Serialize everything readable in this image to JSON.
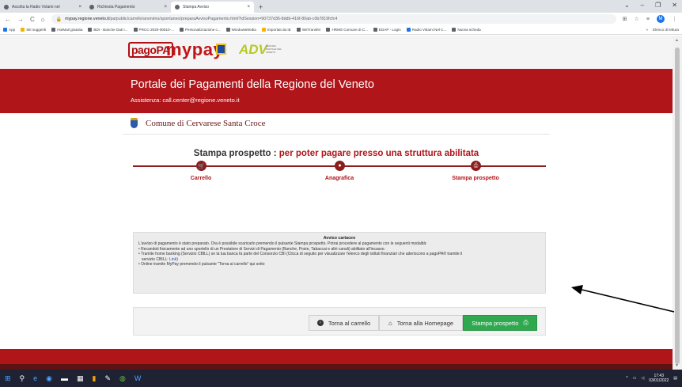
{
  "browser": {
    "tabs": [
      {
        "title": "Ascolta la Radio Volami nel",
        "close": "×",
        "active": false
      },
      {
        "title": "Richiesta Pagamento",
        "close": "×",
        "active": false
      },
      {
        "title": "Stampa Avviso",
        "close": "×",
        "active": true
      }
    ],
    "new_tab": "+",
    "url_host": "mypay.regione.veneto.it",
    "url_path": "/pa/public/carrello/anonimo/spontaneo/preparaAvvisoPagamento.html?idSession=90737d36-8ddb-416f-80ab-c0b7819fcfc4",
    "bookmarks": [
      {
        "label": "App",
        "color": "blue"
      },
      {
        "label": "Siti suggeriti",
        "color": "yellow"
      },
      {
        "label": "HotMail gratuita",
        "color": "grey"
      },
      {
        "label": "BDI - Banche Dati I...",
        "color": "grey"
      },
      {
        "label": "PRCC-2020-00510-...",
        "color": "grey"
      },
      {
        "label": "Personalizzazione c...",
        "color": "grey"
      },
      {
        "label": "WindowsMedia",
        "color": "grey"
      },
      {
        "label": "Importati da IE",
        "color": "yellow"
      },
      {
        "label": "WeTransfer",
        "color": "grey"
      },
      {
        "label": "HRMS Comune di C...",
        "color": "grey"
      },
      {
        "label": "EDAP - Login",
        "color": "grey"
      },
      {
        "label": "Radio Volami Nel C...",
        "color": "blue"
      },
      {
        "label": "Nuova scheda",
        "color": "grey"
      }
    ],
    "bookmarks_more": "»",
    "reading_list": "Elenco di lettura",
    "profile_initial": "M"
  },
  "header": {
    "logo_pagopa": "pagoPA",
    "logo_mypay": "mypay",
    "logo_adv": "ADV",
    "logo_adv_sub": "AGENZIA DIGITALE DEL VENETO",
    "portal_title": "Portale dei Pagamenti della Regione del Veneto",
    "assistance": "Assistenza: call.center@regione.veneto.it",
    "commune": "Comune di Cervarese Santa Croce"
  },
  "main": {
    "title_prefix": "Stampa prospetto : ",
    "title_highlight": "per poter pagare presso una struttura abilitata",
    "steps": [
      {
        "label": "Carrello",
        "icon": "cart-icon"
      },
      {
        "label": "Anagrafica",
        "icon": "user-icon"
      },
      {
        "label": "Stampa prospetto",
        "icon": "print-icon"
      }
    ],
    "notice": {
      "title": "Avviso cartaceo",
      "line1": "L'avviso di pagamento è stato preparato. Ora è possibile scaricarlo premendo il pulsante Stampa prospetto. Potrai procedere al pagamento con le seguenti modalità:",
      "bullet1": "• Recandoti fisicamente ad uno sportello di un Prestatore di Servizi di Pagamento (Banche, Poste, Tabaccai e altri canali) abilitato all'incasso.",
      "bullet2": "• Tramite home banking (Servizio CBILL) se la tua banca fa parte del Consorzio CBI (Clicca di seguito per visualizzare l'elenco degli istituti finanziari che aderiscono a pagoPA® tramite il",
      "bullet2_cont": "servizio CBILL: ",
      "bullet2_link": "Link",
      "bullet2_end": ")",
      "bullet3": "• Online tramite MyPay premendo il pulsante \"Torna al carrello\" qui sotto"
    },
    "buttons": {
      "back_cart": "Torna al carrello",
      "back_home": "Torna alla Homepage",
      "print": "Stampa prospetto"
    }
  },
  "taskbar": {
    "time": "17:43",
    "date": "03/01/2022"
  },
  "colors": {
    "brand_red": "#b0151a",
    "print_green": "#2fa84f"
  }
}
